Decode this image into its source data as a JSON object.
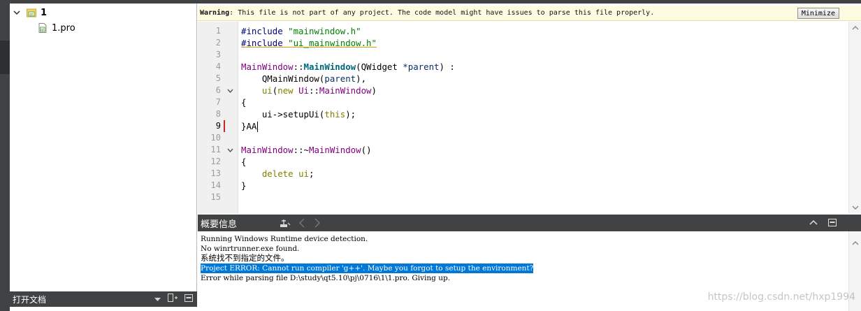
{
  "project_tree": {
    "root_label": "1",
    "child_label": "1.pro"
  },
  "open_documents": {
    "title": "打开文档"
  },
  "warning_bar": {
    "title": "Warning",
    "message": ": This file is not part of any project. The code model might have issues to parse this file properly.",
    "minimize_label": "Minimize"
  },
  "editor": {
    "line_numbers": [
      "1",
      "2",
      "3",
      "4",
      "5",
      "6",
      "7",
      "8",
      "9",
      "10",
      "11",
      "12",
      "13",
      "14",
      "15"
    ],
    "lines": [
      {
        "parts": [
          {
            "t": "#include ",
            "c": "pp"
          },
          {
            "t": "\"mainwindow.h\"",
            "c": "str"
          }
        ]
      },
      {
        "parts": [
          {
            "t": "#include ",
            "c": "pp uline"
          },
          {
            "t": "\"ui_mainwindow.h\"",
            "c": "str uline"
          }
        ]
      },
      {
        "parts": []
      },
      {
        "parts": [
          {
            "t": "MainWindow",
            "c": "cls"
          },
          {
            "t": "::",
            "c": ""
          },
          {
            "t": "MainWindow",
            "c": "fn"
          },
          {
            "t": "(QWidget ",
            "c": ""
          },
          {
            "t": "*parent",
            "c": "param"
          },
          {
            "t": ") :",
            "c": ""
          }
        ]
      },
      {
        "parts": [
          {
            "t": "    QMainWindow(",
            "c": ""
          },
          {
            "t": "parent",
            "c": "param"
          },
          {
            "t": "),",
            "c": ""
          }
        ]
      },
      {
        "parts": [
          {
            "t": "    ",
            "c": ""
          },
          {
            "t": "ui",
            "c": "kw"
          },
          {
            "t": "(",
            "c": ""
          },
          {
            "t": "new ",
            "c": "kw"
          },
          {
            "t": "Ui",
            "c": "cls"
          },
          {
            "t": "::",
            "c": ""
          },
          {
            "t": "MainWindow",
            "c": "cls"
          },
          {
            "t": ")",
            "c": ""
          }
        ]
      },
      {
        "parts": [
          {
            "t": "{",
            "c": ""
          }
        ]
      },
      {
        "parts": [
          {
            "t": "    ui->setupUi(",
            "c": ""
          },
          {
            "t": "this",
            "c": "kw"
          },
          {
            "t": ");",
            "c": ""
          }
        ]
      },
      {
        "parts": [
          {
            "t": "}AA",
            "c": ""
          }
        ]
      },
      {
        "parts": []
      },
      {
        "parts": [
          {
            "t": "MainWindow",
            "c": "cls"
          },
          {
            "t": "::~",
            "c": ""
          },
          {
            "t": "MainWindow",
            "c": "cls"
          },
          {
            "t": "()",
            "c": ""
          }
        ]
      },
      {
        "parts": [
          {
            "t": "{",
            "c": ""
          }
        ]
      },
      {
        "parts": [
          {
            "t": "    ",
            "c": ""
          },
          {
            "t": "delete ",
            "c": "kw"
          },
          {
            "t": "ui",
            "c": "kw"
          },
          {
            "t": ";",
            "c": ""
          }
        ]
      },
      {
        "parts": [
          {
            "t": "}",
            "c": ""
          }
        ]
      },
      {
        "parts": []
      }
    ]
  },
  "output_pane": {
    "title": "概要信息",
    "lines": [
      "Running Windows Runtime device detection.",
      "No winrtrunner.exe found.",
      "系统找不到指定的文件。",
      "Project ERROR: Cannot run compiler 'g++'. Maybe you forgot to setup the environment?",
      "Error while parsing file D:\\study\\qt5.10\\pj\\0716\\1\\1.pro. Giving up."
    ]
  },
  "watermark": "https://blog.csdn.net/hxp1994"
}
